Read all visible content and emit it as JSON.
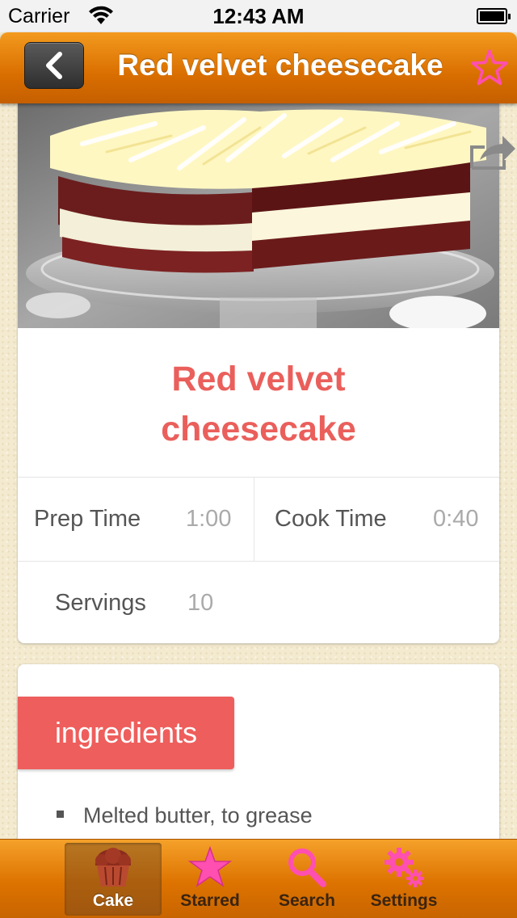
{
  "status_bar": {
    "carrier": "Carrier",
    "time": "12:43 AM"
  },
  "nav": {
    "title": "Red velvet cheesecake"
  },
  "recipe": {
    "title_line1": "Red velvet",
    "title_line2": "cheesecake",
    "prep_time_label": "Prep Time",
    "prep_time_value": "1:00",
    "cook_time_label": "Cook Time",
    "cook_time_value": "0:40",
    "servings_label": "Servings",
    "servings_value": "10"
  },
  "ingredients": {
    "header": "ingredients",
    "items": [
      "Melted butter, to grease"
    ]
  },
  "tabbar": {
    "tabs": [
      {
        "label": "Cake",
        "icon": "muffin-icon"
      },
      {
        "label": "Starred",
        "icon": "star-icon"
      },
      {
        "label": "Search",
        "icon": "search-icon"
      },
      {
        "label": "Settings",
        "icon": "gear-icon"
      }
    ],
    "active": "Cake"
  },
  "colors": {
    "accent_orange": "#dd7300",
    "title_red": "#ea5f5b",
    "star_pink": "#ff4fb0"
  }
}
